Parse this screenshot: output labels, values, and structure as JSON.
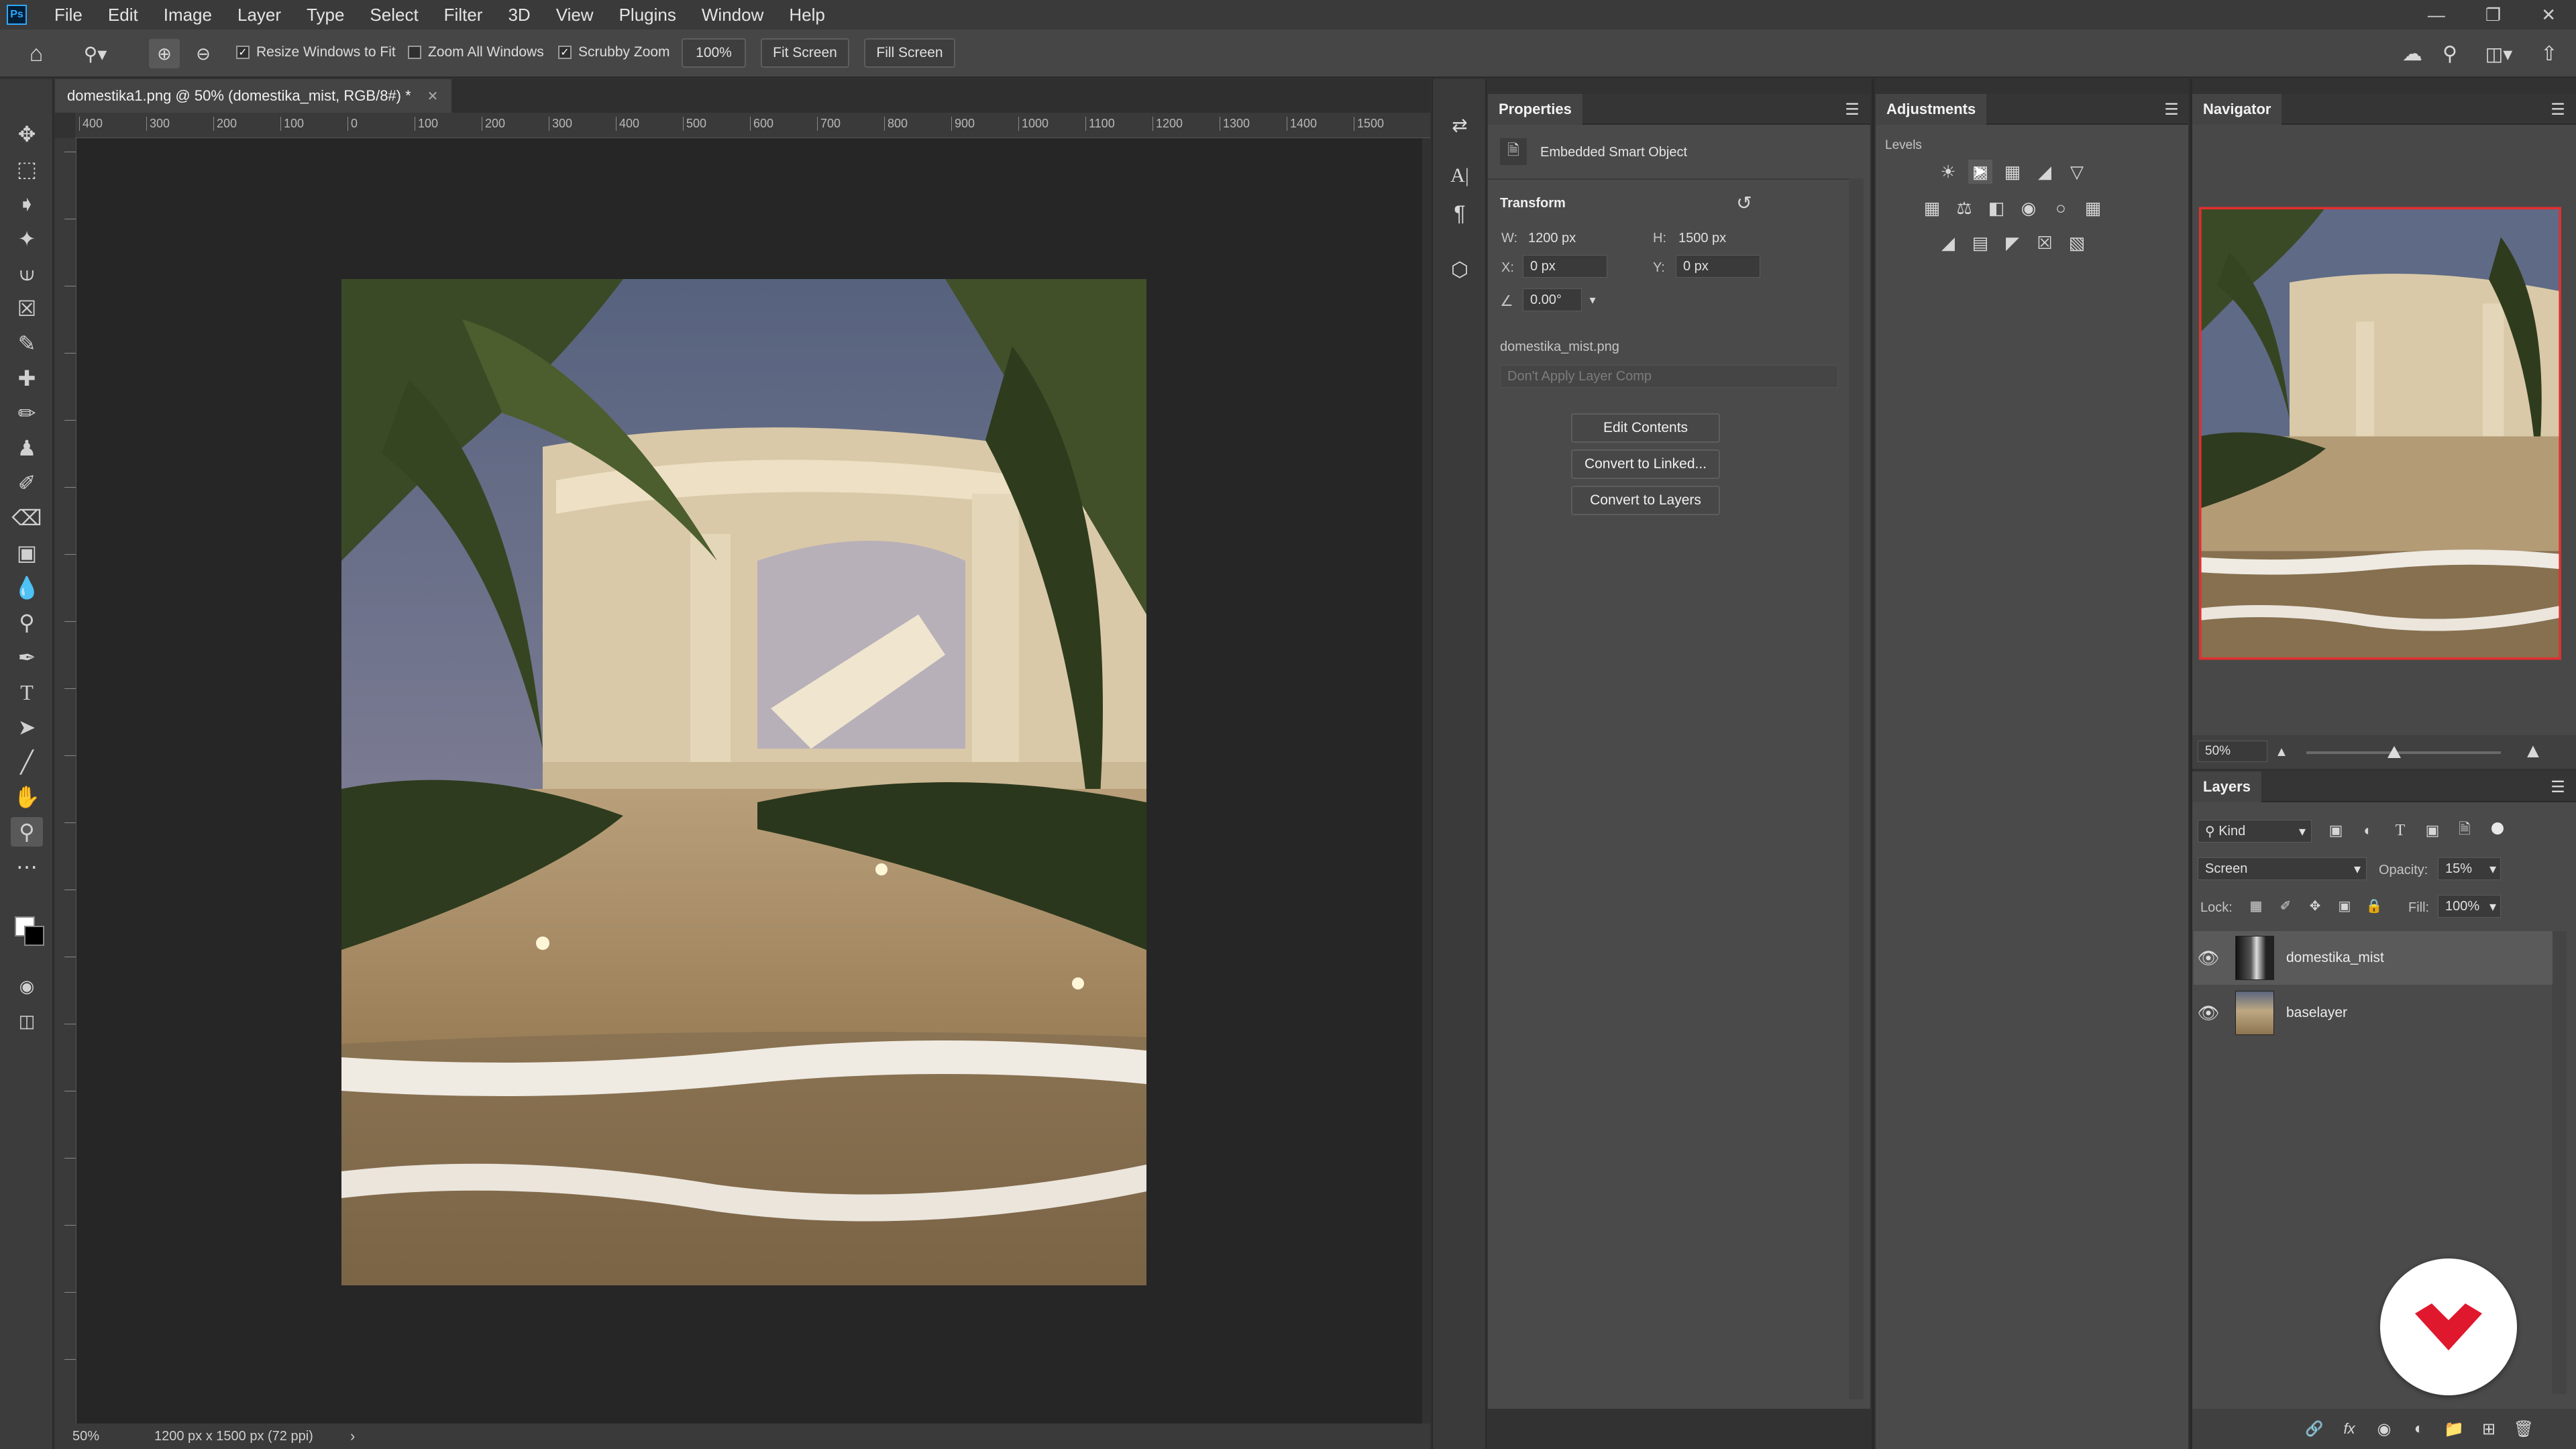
{
  "app": {
    "logo": "Ps",
    "menus": [
      "File",
      "Edit",
      "Image",
      "Layer",
      "Type",
      "Select",
      "Filter",
      "3D",
      "View",
      "Plugins",
      "Window",
      "Help"
    ]
  },
  "options_bar": {
    "resize_windows": "Resize Windows to Fit",
    "zoom_all_windows": "Zoom All Windows",
    "scrubby_zoom": "Scrubby Zoom",
    "zoom_value": "100%",
    "fit_screen": "Fit Screen",
    "fill_screen": "Fill Screen"
  },
  "document": {
    "tab_title": "domestika1.png @ 50% (domestika_mist, RGB/8#) *",
    "ruler_ticks": [
      "400",
      "300",
      "200",
      "100",
      "0",
      "100",
      "200",
      "300",
      "400",
      "500",
      "600",
      "700",
      "800",
      "900",
      "1000",
      "1100",
      "1200",
      "1300",
      "1400",
      "1500"
    ],
    "status_zoom": "50%",
    "status_size": "1200 px x 1500 px (72 ppi)"
  },
  "properties": {
    "tab": "Properties",
    "object_type": "Embedded Smart Object",
    "transform_label": "Transform",
    "w_label": "W:",
    "w_value": "1200 px",
    "h_label": "H:",
    "h_value": "1500 px",
    "x_label": "X:",
    "x_value": "0 px",
    "y_label": "Y:",
    "y_value": "0 px",
    "angle_value": "0.00°",
    "filename": "domestika_mist.png",
    "layer_comp": "Don't Apply Layer Comp",
    "edit_contents": "Edit Contents",
    "convert_linked": "Convert to Linked...",
    "convert_layers": "Convert to Layers"
  },
  "adjustments": {
    "tab": "Adjustments",
    "hover_label": "Levels"
  },
  "navigator": {
    "tab": "Navigator",
    "zoom": "50%",
    "zoom_slider_fraction": 0.45
  },
  "layers": {
    "tab": "Layers",
    "filter_kind": "Kind",
    "blend_mode": "Screen",
    "opacity_label": "Opacity:",
    "opacity_value": "15%",
    "lock_label": "Lock:",
    "fill_label": "Fill:",
    "fill_value": "100%",
    "items": [
      {
        "name": "domestika_mist",
        "selected": true
      },
      {
        "name": "baselayer",
        "selected": false
      }
    ]
  },
  "colors": {
    "accent_red": "#e0182d",
    "nav_frame": "#e03030"
  }
}
